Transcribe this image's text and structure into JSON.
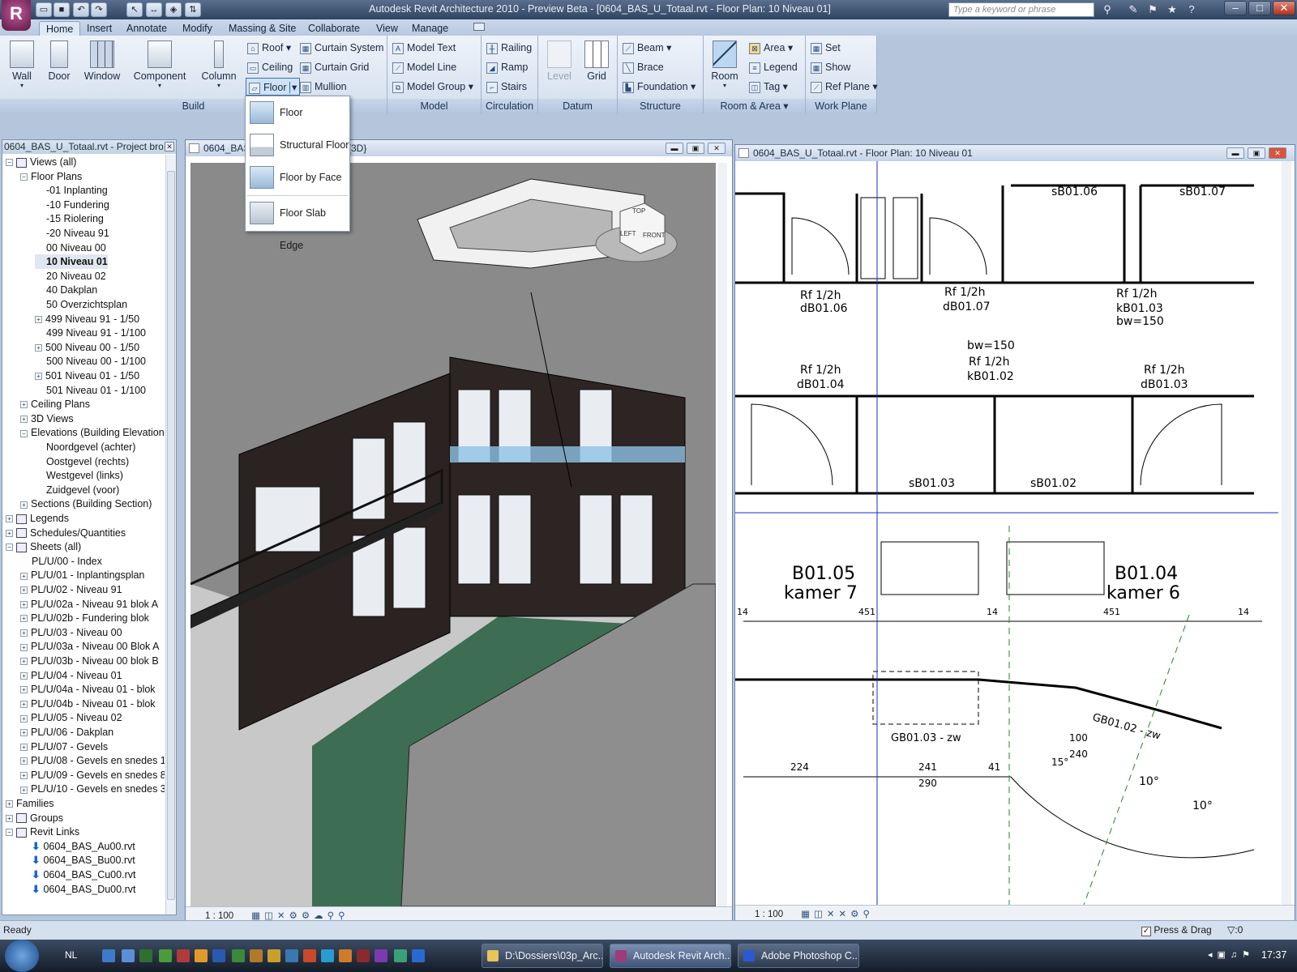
{
  "window": {
    "title": "Autodesk Revit Architecture 2010 - Preview Beta - [0604_BAS_U_Totaal.rvt - Floor Plan: 10 Niveau 01]",
    "search_placeholder": "Type a keyword or phrase",
    "minimize": "–",
    "maximize": "□",
    "close": "✕"
  },
  "tabs": [
    "Home",
    "Insert",
    "Annotate",
    "Modify",
    "Massing & Site",
    "Collaborate",
    "View",
    "Manage"
  ],
  "ribbon": {
    "build": {
      "label": "Build",
      "wall": "Wall",
      "door": "Door",
      "window": "Window",
      "component": "Component",
      "column": "Column",
      "roof": "Roof",
      "ceiling": "Ceiling",
      "floor": "Floor",
      "curtain_system": "Curtain System",
      "curtain_grid": "Curtain Grid",
      "mullion": "Mullion"
    },
    "model": {
      "label": "Model",
      "model_text": "Model Text",
      "model_line": "Model Line",
      "model_group": "Model Group"
    },
    "circulation": {
      "label": "Circulation",
      "railing": "Railing",
      "ramp": "Ramp",
      "stairs": "Stairs"
    },
    "datum": {
      "label": "Datum",
      "level": "Level",
      "grid": "Grid"
    },
    "structure": {
      "label": "Structure",
      "beam": "Beam",
      "brace": "Brace",
      "foundation": "Foundation"
    },
    "room_area": {
      "label": "Room & Area",
      "room": "Room",
      "area": "Area",
      "legend": "Legend",
      "tag": "Tag"
    },
    "work_plane": {
      "label": "Work Plane",
      "set": "Set",
      "show": "Show",
      "ref_plane": "Ref Plane"
    }
  },
  "floor_menu": [
    "Floor",
    "Structural Floor",
    "Floor by Face",
    "Floor Slab Edge"
  ],
  "browser": {
    "title": "0604_BAS_U_Totaal.rvt - Project bro...",
    "items": [
      {
        "label": "Views (all)",
        "level": 0,
        "exp": "−",
        "icon": true
      },
      {
        "label": "Floor Plans",
        "level": 1,
        "exp": "−"
      },
      {
        "label": "-01 Inplanting",
        "level": 2
      },
      {
        "label": "-10 Fundering",
        "level": 2
      },
      {
        "label": "-15 Riolering",
        "level": 2
      },
      {
        "label": "-20 Niveau 91",
        "level": 2
      },
      {
        "label": "00 Niveau 00",
        "level": 2
      },
      {
        "label": "10 Niveau 01",
        "level": 2,
        "sel": true
      },
      {
        "label": "20 Niveau 02",
        "level": 2
      },
      {
        "label": "40 Dakplan",
        "level": 2
      },
      {
        "label": "50 Overzichtsplan",
        "level": 2
      },
      {
        "label": "499 Niveau 91 - 1/50",
        "level": 2,
        "exp": "+"
      },
      {
        "label": "499 Niveau 91 - 1/100",
        "level": 2
      },
      {
        "label": "500 Niveau 00 - 1/50",
        "level": 2,
        "exp": "+"
      },
      {
        "label": "500 Niveau 00 - 1/100",
        "level": 2
      },
      {
        "label": "501 Niveau 01 - 1/50",
        "level": 2,
        "exp": "+"
      },
      {
        "label": "501 Niveau 01 - 1/100",
        "level": 2
      },
      {
        "label": "Ceiling Plans",
        "level": 1,
        "exp": "+"
      },
      {
        "label": "3D Views",
        "level": 1,
        "exp": "+"
      },
      {
        "label": "Elevations (Building Elevation",
        "level": 1,
        "exp": "−"
      },
      {
        "label": "Noordgevel (achter)",
        "level": 2
      },
      {
        "label": "Oostgevel (rechts)",
        "level": 2
      },
      {
        "label": "Westgevel (links)",
        "level": 2
      },
      {
        "label": "Zuidgevel (voor)",
        "level": 2
      },
      {
        "label": "Sections (Building Section)",
        "level": 1,
        "exp": "+"
      },
      {
        "label": "Legends",
        "level": 0,
        "exp": "+",
        "icon": true
      },
      {
        "label": "Schedules/Quantities",
        "level": 0,
        "exp": "+",
        "icon": true
      },
      {
        "label": "Sheets (all)",
        "level": 0,
        "exp": "−",
        "icon": true
      },
      {
        "label": "PL/U/00 - Index",
        "level": 1
      },
      {
        "label": "PL/U/01 - Inplantingsplan",
        "level": 1,
        "exp": "+"
      },
      {
        "label": "PL/U/02 - Niveau 91",
        "level": 1,
        "exp": "+"
      },
      {
        "label": "PL/U/02a - Niveau 91 blok A",
        "level": 1,
        "exp": "+"
      },
      {
        "label": "PL/U/02b - Fundering  blok",
        "level": 1,
        "exp": "+"
      },
      {
        "label": "PL/U/03 - Niveau 00",
        "level": 1,
        "exp": "+"
      },
      {
        "label": "PL/U/03a - Niveau 00 Blok A",
        "level": 1,
        "exp": "+"
      },
      {
        "label": "PL/U/03b - Niveau 00 blok B",
        "level": 1,
        "exp": "+"
      },
      {
        "label": "PL/U/04 - Niveau 01",
        "level": 1,
        "exp": "+"
      },
      {
        "label": "PL/U/04a - Niveau 01 - blok",
        "level": 1,
        "exp": "+"
      },
      {
        "label": "PL/U/04b - Niveau 01 - blok",
        "level": 1,
        "exp": "+"
      },
      {
        "label": "PL/U/05 - Niveau 02",
        "level": 1,
        "exp": "+"
      },
      {
        "label": "PL/U/06 - Dakplan",
        "level": 1,
        "exp": "+"
      },
      {
        "label": "PL/U/07 - Gevels",
        "level": 1,
        "exp": "+"
      },
      {
        "label": "PL/U/08 - Gevels en snedes 1",
        "level": 1,
        "exp": "+"
      },
      {
        "label": "PL/U/09 - Gevels en snedes 8",
        "level": 1,
        "exp": "+"
      },
      {
        "label": "PL/U/10 - Gevels en snedes 3",
        "level": 1,
        "exp": "+"
      },
      {
        "label": "Families",
        "level": 0,
        "exp": "+"
      },
      {
        "label": "Groups",
        "level": 0,
        "exp": "+",
        "icon": true
      },
      {
        "label": "Revit Links",
        "level": 0,
        "exp": "−",
        "icon": true
      },
      {
        "label": "0604_BAS_Au00.rvt",
        "level": 1,
        "link": true
      },
      {
        "label": "0604_BAS_Bu00.rvt",
        "level": 1,
        "link": true
      },
      {
        "label": "0604_BAS_Cu00.rvt",
        "level": 1,
        "link": true
      },
      {
        "label": "0604_BAS_Du00.rvt",
        "level": 1,
        "link": true
      }
    ]
  },
  "view3d": {
    "title": "0604_BAS",
    "title_suffix": "{3D}",
    "scale": "1 : 100",
    "cube_top": "TOP",
    "cube_left": "LEFT",
    "cube_front": "FRONT"
  },
  "viewplan": {
    "title": "0604_BAS_U_Totaal.rvt - Floor Plan: 10 Niveau 01",
    "scale": "1 : 100",
    "labels": {
      "sb0106": "sB01.06",
      "sb0107": "sB01.07",
      "rf1": "Rf 1/2h",
      "db0106": "dB01.06",
      "rf2": "Rf 1/2h",
      "db0107": "dB01.07",
      "rf3": "Rf 1/2h",
      "kb0103": "kB01.03",
      "bw1": "bw=150",
      "bw2": "bw=150",
      "rf4": "Rf 1/2h",
      "kb0102": "kB01.02",
      "rf5": "Rf 1/2h",
      "db0104": "dB01.04",
      "rf6": "Rf 1/2h",
      "db0103": "dB01.03",
      "sb0103": "sB01.03",
      "sb0102": "sB01.02",
      "b0105": "B01.05",
      "kamer7": "kamer 7",
      "b0104": "B01.04",
      "kamer6": "kamer 6",
      "d451a": "451",
      "d451b": "451",
      "d14a": "14",
      "d14b": "14",
      "d14c": "14",
      "gb0103": "GB01.03 - zw",
      "gb0102": "GB01.02 - zw",
      "d224": "224",
      "d241": "241",
      "d41": "41",
      "d290": "290",
      "d100": "100",
      "d240": "240",
      "a15": "15°",
      "a10a": "10°",
      "a10b": "10°"
    }
  },
  "status": {
    "text": "Ready",
    "press_drag": "Press & Drag",
    "filter": ":0"
  },
  "taskbar": {
    "lang": "NL",
    "apps": [
      "D:\\Dossiers\\03p_Arc...",
      "Autodesk Revit Arch...",
      "Adobe Photoshop C..."
    ],
    "time": "17:37"
  }
}
